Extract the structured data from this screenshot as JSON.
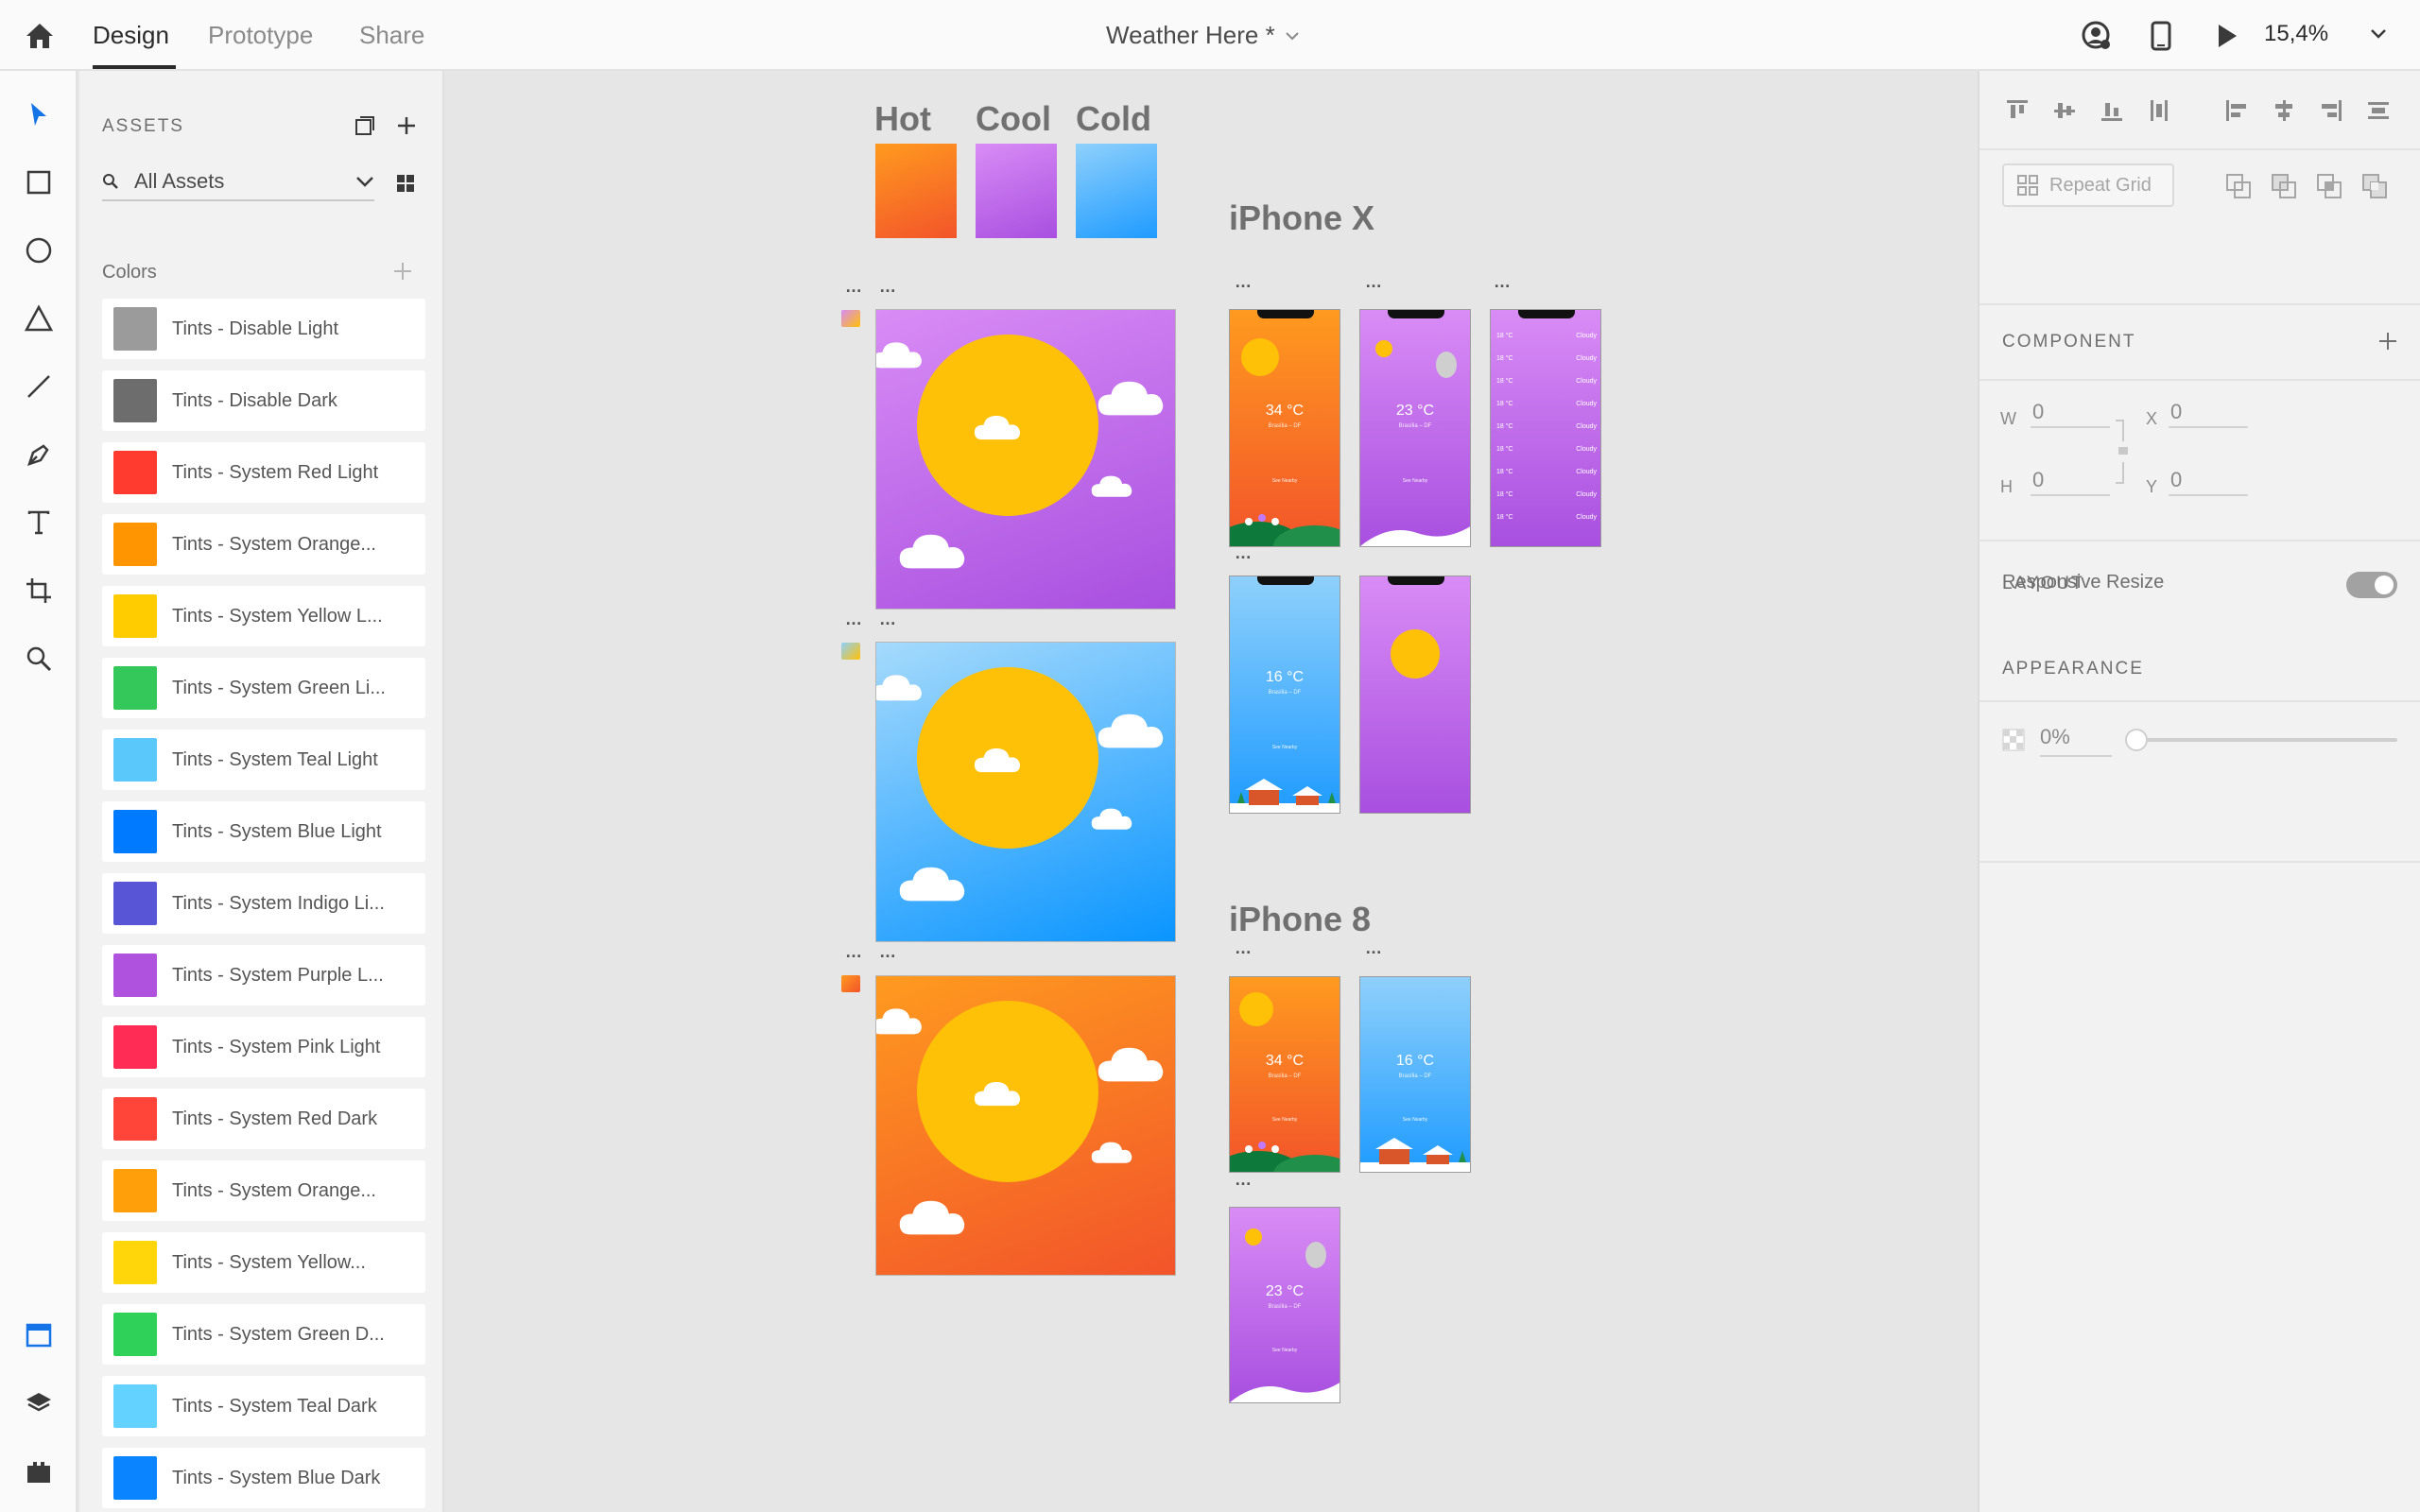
{
  "app": {
    "tabs": [
      {
        "label": "Design",
        "active": true
      },
      {
        "label": "Prototype",
        "active": false
      },
      {
        "label": "Share",
        "active": false
      }
    ],
    "document_title": "Weather Here *",
    "zoom": "15,4%"
  },
  "assets": {
    "title": "ASSETS",
    "filter": "All Assets",
    "colors_title": "Colors",
    "colors": [
      {
        "name": "Tints - Disable Light",
        "hex": "#9b9b9b"
      },
      {
        "name": "Tints - Disable Dark",
        "hex": "#6d6d6d"
      },
      {
        "name": "Tints - System Red Light",
        "hex": "#ff3b30"
      },
      {
        "name": "Tints - System Orange...",
        "hex": "#ff9500"
      },
      {
        "name": "Tints - System Yellow L...",
        "hex": "#ffcc00"
      },
      {
        "name": "Tints - System Green Li...",
        "hex": "#34c759"
      },
      {
        "name": "Tints - System Teal Light",
        "hex": "#5ac8fa"
      },
      {
        "name": "Tints - System Blue Light",
        "hex": "#007aff"
      },
      {
        "name": "Tints - System Indigo Li...",
        "hex": "#5856d6"
      },
      {
        "name": "Tints - System Purple L...",
        "hex": "#af52de"
      },
      {
        "name": "Tints - System Pink Light",
        "hex": "#ff2d55"
      },
      {
        "name": "Tints - System Red Dark",
        "hex": "#ff453a"
      },
      {
        "name": "Tints - System Orange...",
        "hex": "#ff9f0a"
      },
      {
        "name": "Tints - System Yellow...",
        "hex": "#ffd60a"
      },
      {
        "name": "Tints - System Green D...",
        "hex": "#30d158"
      },
      {
        "name": "Tints - System Teal Dark",
        "hex": "#64d2ff"
      },
      {
        "name": "Tints - System Blue Dark",
        "hex": "#0a84ff"
      }
    ]
  },
  "canvas": {
    "gradient_labels": [
      "Hot",
      "Cool",
      "Cold"
    ],
    "dots": "…",
    "iphone_x_title": "iPhone X",
    "iphone_8_title": "iPhone 8",
    "hot_temp": "34 °C",
    "cool_temp": "23 °C",
    "cold_temp": "16 °C",
    "location": "Brasília – DF",
    "see_nearby": "See Nearby",
    "list_temp": "18 °C",
    "list_condition": "Cloudy",
    "list_location": "Brasília – DF"
  },
  "inspector": {
    "repeat_grid": "Repeat Grid",
    "component": "COMPONENT",
    "w_label": "W",
    "w_value": "0",
    "h_label": "H",
    "h_value": "0",
    "x_label": "X",
    "x_value": "0",
    "y_label": "Y",
    "y_value": "0",
    "layout": "LAYOUT",
    "responsive_resize": "Responsive Resize",
    "responsive_resize_on": true,
    "appearance": "APPEARANCE",
    "opacity": "0%"
  },
  "colors": {
    "accent_blue": "#1473e6",
    "hot_gradient": [
      "#ff9a1f",
      "#f2542a"
    ],
    "cool_gradient": [
      "#d98cf5",
      "#a84fe0"
    ],
    "cold_gradient": [
      "#8fd0fb",
      "#1e9bff"
    ]
  }
}
